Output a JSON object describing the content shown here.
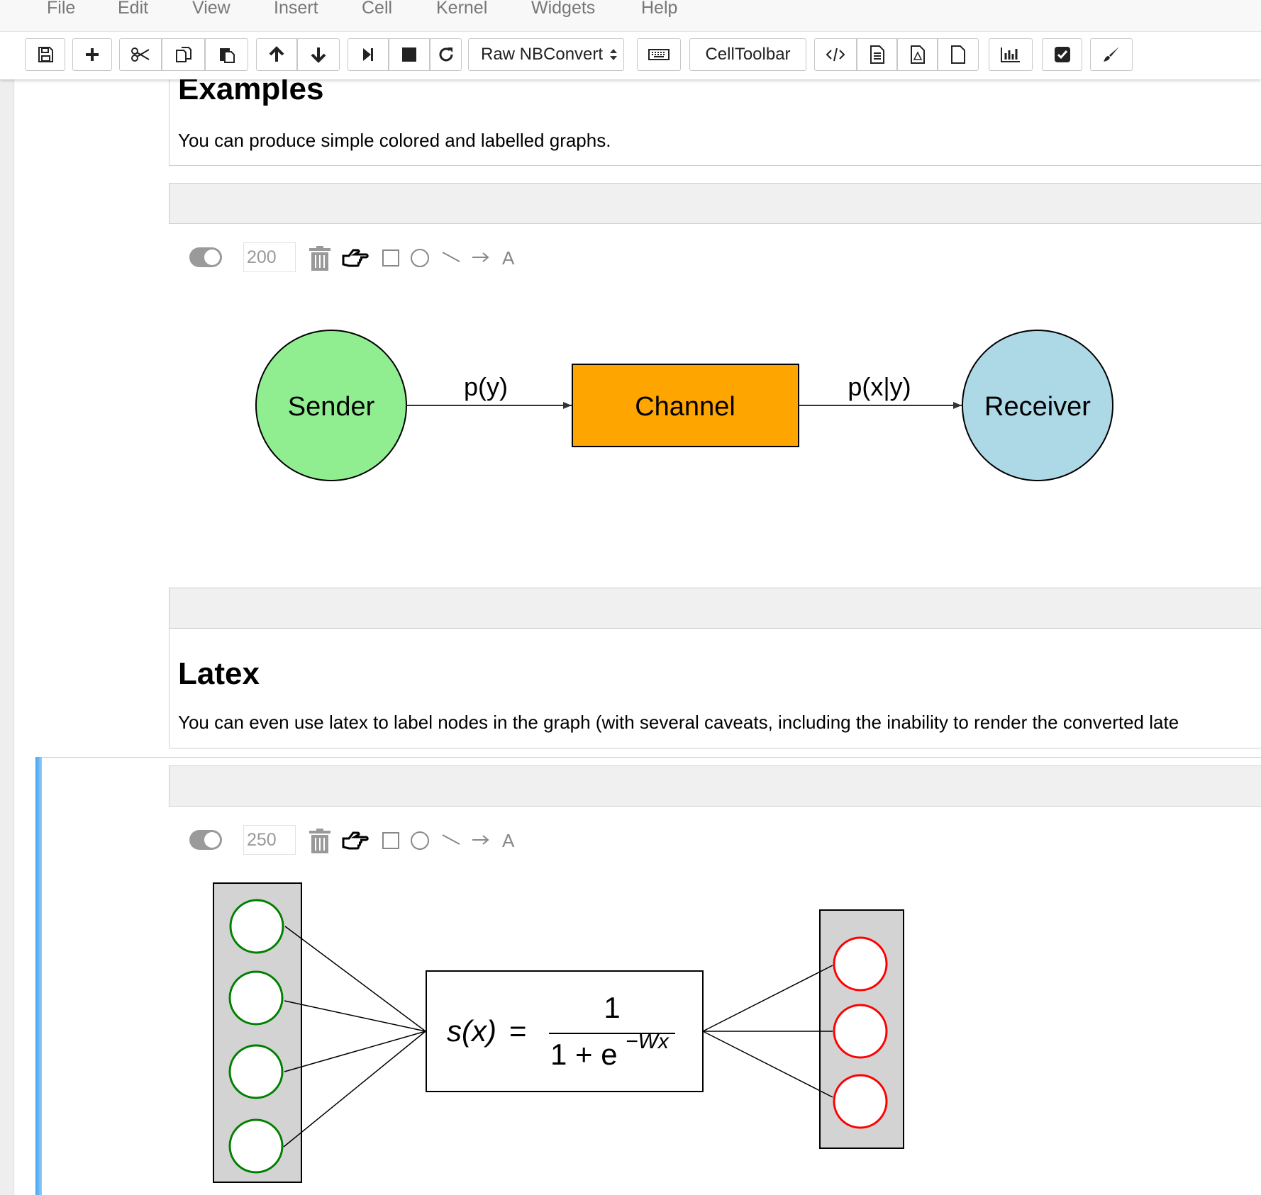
{
  "menubar": {
    "items": [
      "File",
      "Edit",
      "View",
      "Insert",
      "Cell",
      "Kernel",
      "Widgets",
      "Help"
    ]
  },
  "toolbar": {
    "cell_type": "Raw NBConvert",
    "celltoolbar_label": "CellToolbar",
    "icons": [
      "save-icon",
      "plus-icon",
      "scissors-icon",
      "copy-icon",
      "paste-icon",
      "arrow-up-icon",
      "arrow-down-icon",
      "step-forward-icon",
      "stop-icon",
      "refresh-icon",
      "keyboard-icon",
      "code-icon",
      "file-text-icon",
      "file-pdf-icon",
      "file-icon",
      "bar-chart-icon",
      "check-square-icon",
      "paint-brush-icon"
    ]
  },
  "cells": {
    "examples": {
      "heading": "Examples",
      "text": "You can produce simple colored and labelled graphs."
    },
    "graph1": {
      "size": "200",
      "nodes": {
        "sender": {
          "label": "Sender",
          "color": "#90ee90"
        },
        "channel": {
          "label": "Channel",
          "color": "#ffa500"
        },
        "receiver": {
          "label": "Receiver",
          "color": "#add8e6"
        }
      },
      "edges": {
        "e1": "p(y)",
        "e2": "p(x|y)"
      }
    },
    "latex": {
      "heading": "Latex",
      "text": "You can even use latex to label nodes in the graph (with several caveats, including the inability to render the converted late"
    },
    "graph2": {
      "size": "250",
      "formula": {
        "lhs": "s(x)",
        "equals": "=",
        "numerator": "1",
        "denominator": "1 + e",
        "exponent": "−Wx"
      },
      "input_color": "#008000",
      "output_color": "#ff0000"
    }
  },
  "canvas_tools": {
    "text_tool": "A",
    "icons": [
      "toggle-switch",
      "trash-icon",
      "hand-pointer-icon",
      "square-icon",
      "circle-icon",
      "line-icon",
      "arrow-icon",
      "text-icon"
    ]
  }
}
